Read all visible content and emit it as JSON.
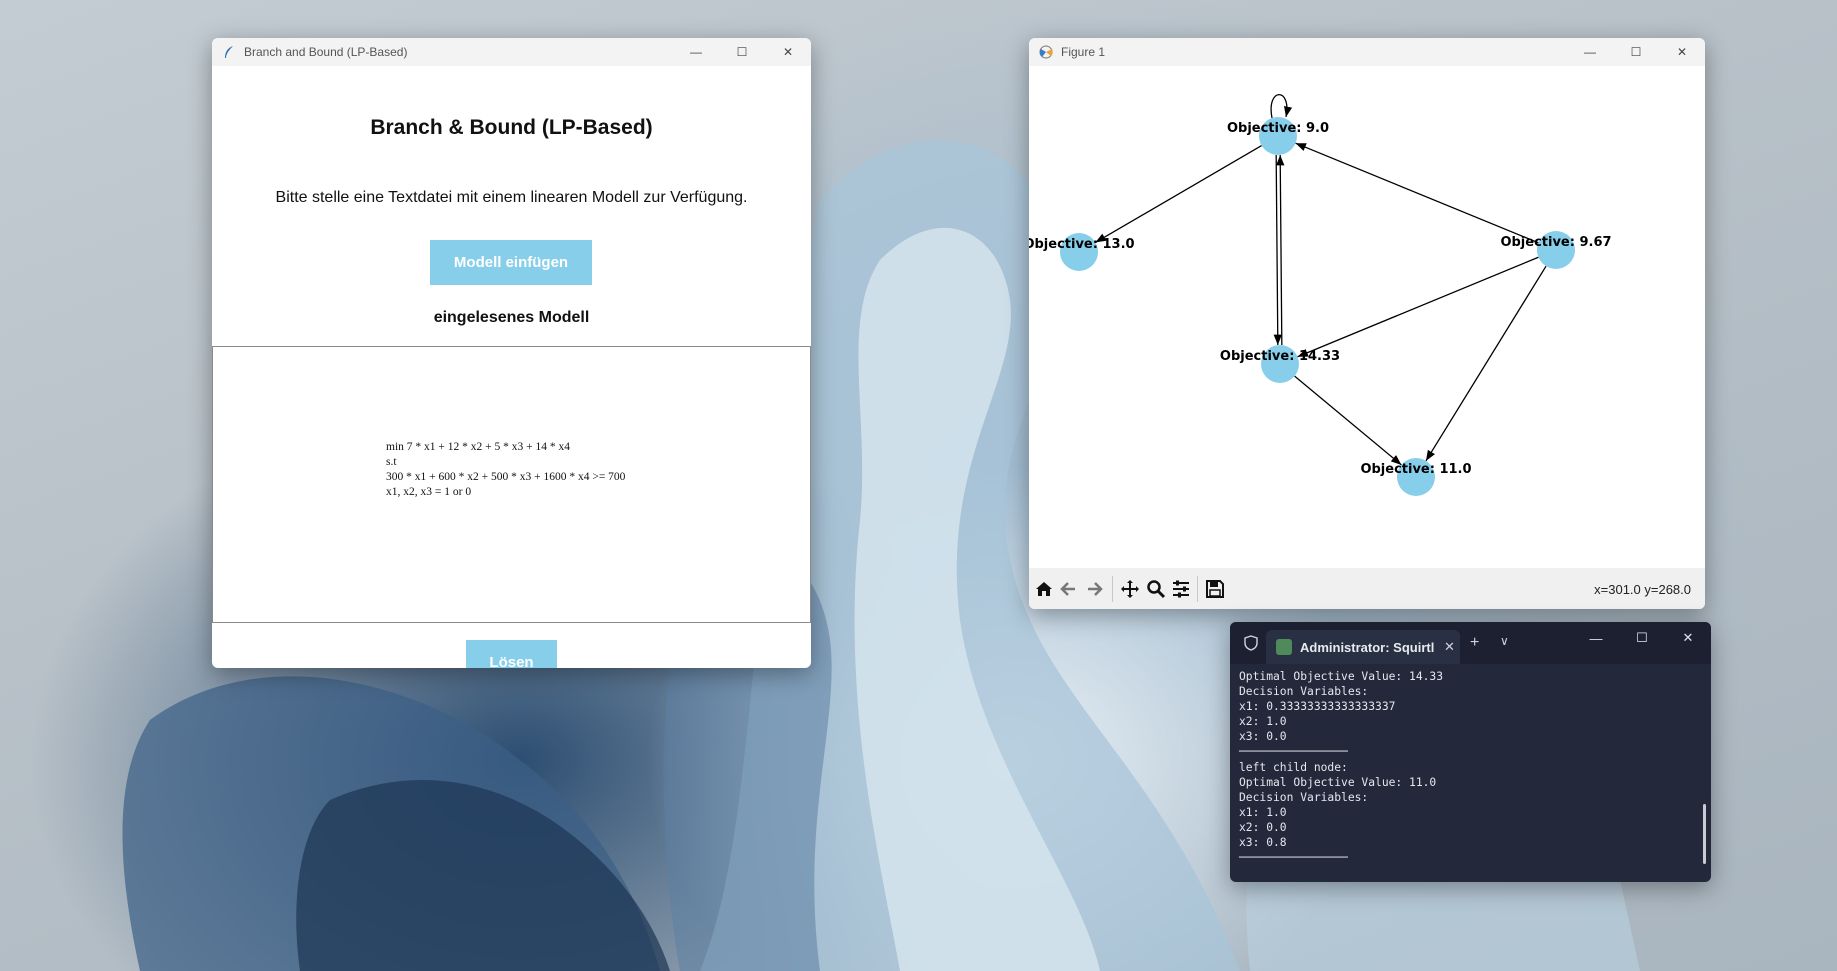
{
  "tk_window": {
    "title": "Branch and Bound (LP-Based)",
    "heading": "Branch & Bound (LP-Based)",
    "info_text": "Bitte stelle eine Textdatei mit einem linearen Modell zur Verfügung.",
    "insert_button": "Modell einfügen",
    "model_heading": "eingelesenes Modell",
    "model_lines": [
      "min 7 * x1 + 12 * x2 + 5 * x3 + 14 * x4",
      "",
      "s.t",
      "300 * x1 + 600 * x2 + 500 * x3 + 1600 * x4 >= 700",
      "",
      "x1, x2, x3 = 1 or 0"
    ],
    "solve_button": "Lösen"
  },
  "figure_window": {
    "title": "Figure 1",
    "coordinates": "x=301.0 y=268.0",
    "toolbar": [
      "home-icon",
      "back-icon",
      "forward-icon",
      "pan-icon",
      "zoom-icon",
      "configure-icon",
      "save-icon"
    ]
  },
  "chart_data": {
    "type": "graph",
    "node_color": "#87ceeb",
    "nodes": [
      {
        "id": "n9",
        "label": "Objective: 9.0"
      },
      {
        "id": "n13",
        "label": "Objective: 13.0"
      },
      {
        "id": "n967",
        "label": "Objective: 9.67"
      },
      {
        "id": "n1433",
        "label": "Objective: 14.33"
      },
      {
        "id": "n11",
        "label": "Objective: 11.0"
      }
    ],
    "edges": [
      {
        "from": "n9",
        "to": "n9"
      },
      {
        "from": "n9",
        "to": "n13"
      },
      {
        "from": "n9",
        "to": "n1433"
      },
      {
        "from": "n1433",
        "to": "n9"
      },
      {
        "from": "n967",
        "to": "n9"
      },
      {
        "from": "n967",
        "to": "n1433"
      },
      {
        "from": "n967",
        "to": "n11"
      },
      {
        "from": "n1433",
        "to": "n11"
      }
    ]
  },
  "terminal": {
    "tab_title": "Administrator: Squirtl",
    "lines": [
      "Optimal Objective Value: 14.33",
      "Decision Variables:",
      "x1: 0.33333333333333337",
      "x2: 1.0",
      "x3: 0.0",
      "────────────────",
      "left child node:",
      "Optimal Objective Value: 11.0",
      "Decision Variables:",
      "x1: 1.0",
      "x2: 0.0",
      "x3: 0.8",
      "────────────────"
    ]
  }
}
